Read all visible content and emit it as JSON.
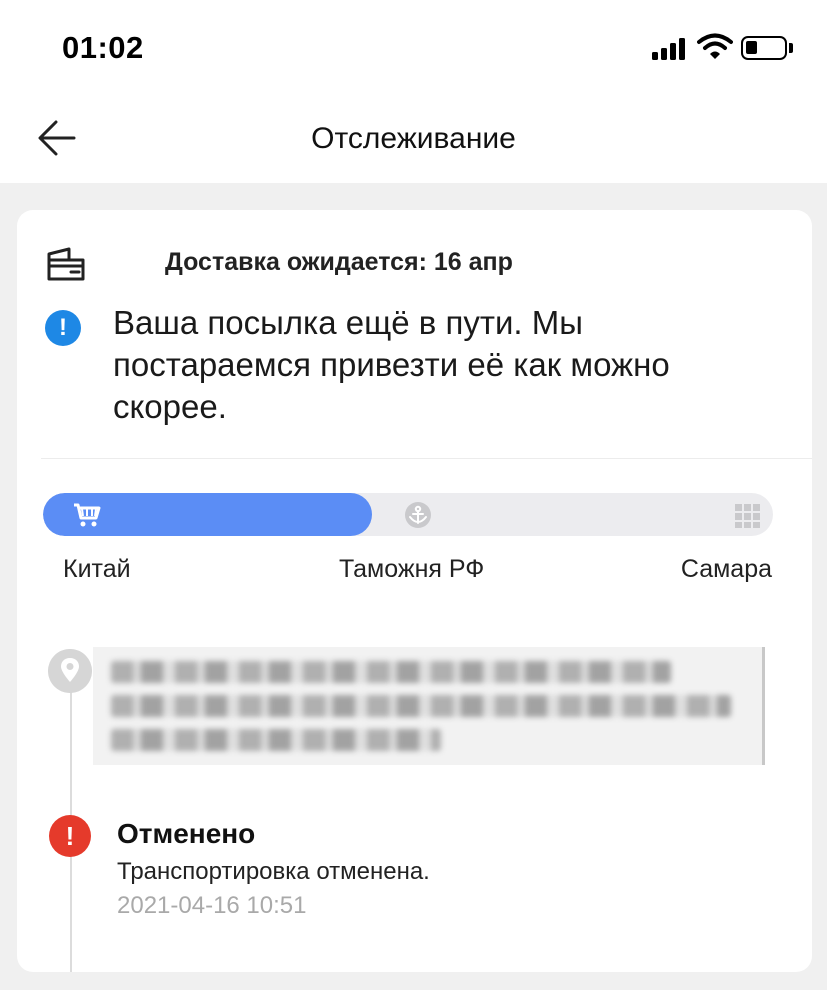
{
  "status_bar": {
    "time": "01:02",
    "battery_level": 0.3
  },
  "nav": {
    "title": "Отслеживание",
    "back_icon": "arrow-left-icon"
  },
  "delivery": {
    "icon": "wallet-icon",
    "expected_label": "Доставка ожидается: 16 апр"
  },
  "notice": {
    "icon": "info-icon",
    "text": "Ваша посылка ещё в пути. Мы постараемся привезти её как можно скорее."
  },
  "progress": {
    "fill_fraction": 0.45,
    "accent_color": "#5b8df5",
    "stages": [
      {
        "label": "Китай",
        "icon": "cart-icon"
      },
      {
        "label": "Таможня РФ",
        "icon": "anchor-icon"
      },
      {
        "label": "Самара",
        "icon": "grid-icon"
      }
    ]
  },
  "timeline": {
    "location_icon": "location-pin-icon",
    "event": {
      "icon": "alert-icon",
      "status_color": "#e53a2b",
      "title": "Отменено",
      "description": "Транспортировка отменена.",
      "timestamp": "2021-04-16 10:51"
    }
  }
}
